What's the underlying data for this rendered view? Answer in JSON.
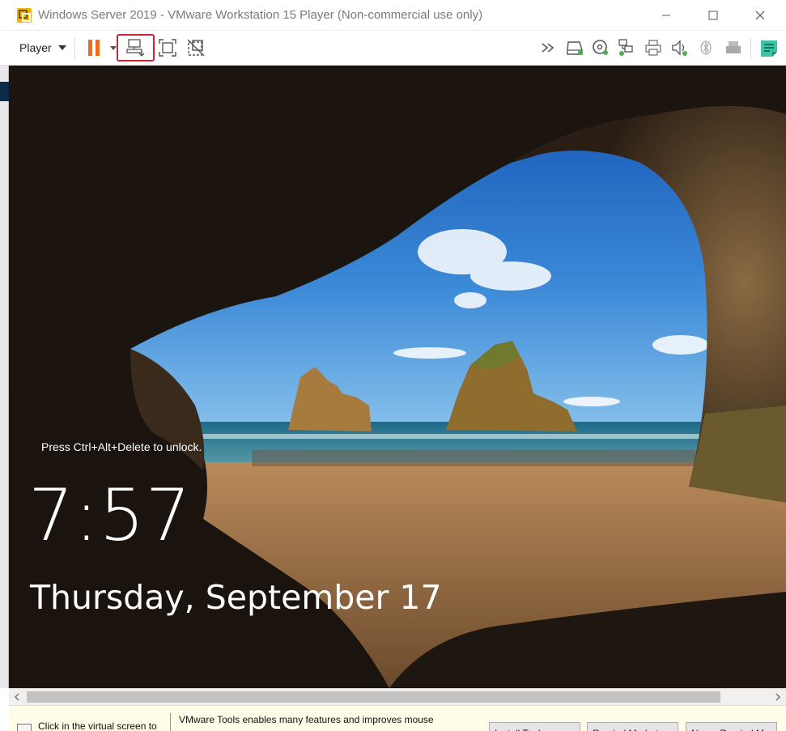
{
  "window": {
    "title": "Windows Server 2019 - VMware Workstation 15 Player (Non-commercial use only)",
    "controls": {
      "minimize": "—",
      "maximize": "☐",
      "close": "✕"
    }
  },
  "toolbar": {
    "player_label": "Player",
    "icons": [
      "pause-icon",
      "send-ctrl-alt-del-icon",
      "fullscreen-icon",
      "unity-icon",
      "more-icon",
      "hard-disk-icon",
      "cd-dvd-icon",
      "network-adapter-icon",
      "printer-icon",
      "sound-card-icon",
      "bluetooth-icon",
      "usb-printer-icon",
      "message-log-icon"
    ],
    "highlight_color": "#d0252e",
    "pause_color": "#f26b1d"
  },
  "lock_screen": {
    "unlock_hint": "Press Ctrl+Alt+Delete to unlock.",
    "time": "7:57",
    "date": "Thursday, September 17"
  },
  "notification": {
    "click_hint": "Click in the virtual screen to",
    "tools_message": "VMware Tools enables many features and improves mouse",
    "buttons": [
      "Install Tools",
      "Remind Me Later",
      "Never Remind Me"
    ]
  }
}
